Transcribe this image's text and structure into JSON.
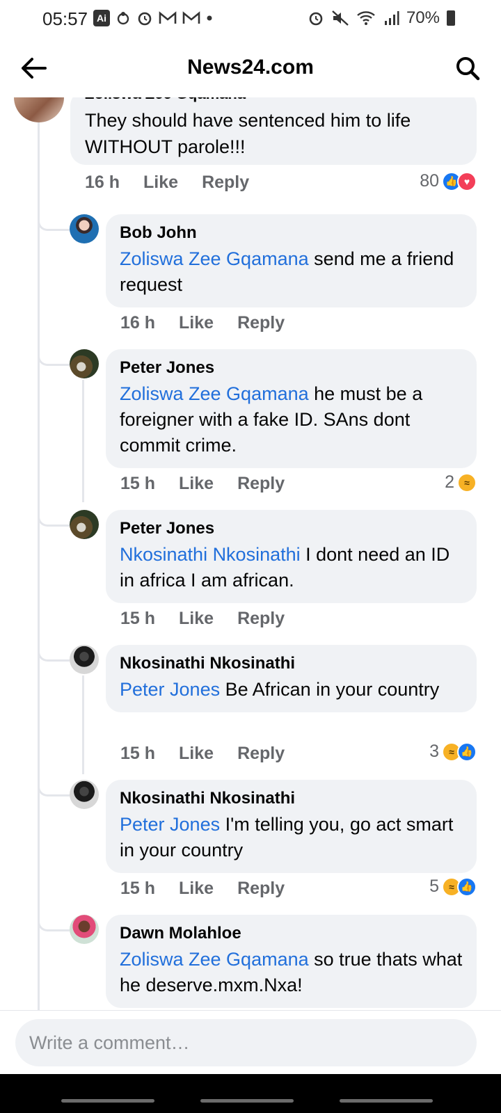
{
  "status_bar": {
    "time": "05:57",
    "left_icons": [
      "ai-icon",
      "notification-icon",
      "alarm-icon",
      "gmail-icon",
      "gmail-icon",
      "dot-icon"
    ],
    "battery": "70%"
  },
  "header": {
    "title": "News24.com"
  },
  "parent_comment": {
    "name": "Zoliswa Zee Gqamana",
    "text": "They should have sentenced him to life WITHOUT parole!!!",
    "time": "16 h",
    "like_label": "Like",
    "reply_label": "Reply",
    "reaction_count": "80",
    "reactions": [
      "like",
      "love"
    ]
  },
  "replies": [
    {
      "name": "Bob John",
      "mention": "Zoliswa Zee Gqamana",
      "text": " send me a friend request",
      "time": "16 h",
      "like_label": "Like",
      "reply_label": "Reply",
      "reaction_count": "",
      "reactions": []
    },
    {
      "name": "Peter Jones",
      "mention": "Zoliswa Zee Gqamana",
      "text": " he must be a foreigner with a fake ID. SAns dont commit crime.",
      "time": "15 h",
      "like_label": "Like",
      "reply_label": "Reply",
      "reaction_count": "2",
      "reactions": [
        "haha"
      ]
    },
    {
      "name": "Peter Jones",
      "mention": "Nkosinathi Nkosinathi",
      "text": " I dont need an ID in africa I am african.",
      "time": "15 h",
      "like_label": "Like",
      "reply_label": "Reply",
      "reaction_count": "",
      "reactions": []
    },
    {
      "name": "Nkosinathi Nkosinathi",
      "mention": "Peter Jones",
      "text": " Be African in your country",
      "time": "15 h",
      "like_label": "Like",
      "reply_label": "Reply",
      "reaction_count": "3",
      "reactions": [
        "haha",
        "like"
      ]
    },
    {
      "name": "Nkosinathi Nkosinathi",
      "mention": "Peter Jones",
      "text": " I'm telling you, go act smart in your country",
      "time": "15 h",
      "like_label": "Like",
      "reply_label": "Reply",
      "reaction_count": "5",
      "reactions": [
        "haha",
        "like"
      ]
    },
    {
      "name": "Dawn Molahloe",
      "mention": "Zoliswa Zee Gqamana",
      "text": " so true thats what he deserve.mxm.Nxa!",
      "time": "",
      "like_label": "",
      "reply_label": "",
      "reaction_count": "",
      "reactions": []
    }
  ],
  "composer": {
    "placeholder": "Write a comment…"
  },
  "colors": {
    "mention": "#216fdb",
    "bubble": "#f0f2f5",
    "meta": "#65676b",
    "like": "#1877f2",
    "love": "#f33e58",
    "haha": "#f7b125"
  }
}
